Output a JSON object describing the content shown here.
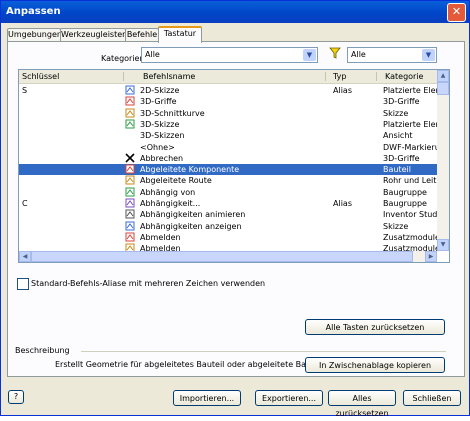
{
  "window": {
    "title": "Anpassen",
    "close_glyph": "✕"
  },
  "tabs": [
    "Umgebungen",
    "Werkzeugleisten",
    "Befehle",
    "Tastatur"
  ],
  "active_tab": "Tastatur",
  "kategorie": {
    "label": "Kategorien",
    "value": "Alle"
  },
  "filter": {
    "icon": "funnel-icon",
    "value": "Alle"
  },
  "table": {
    "columns": [
      "Schlüssel",
      "Befehlsname",
      "Typ",
      "Kategorie"
    ],
    "rows": [
      {
        "key": "S",
        "name": "2D-Skizze",
        "type": "Alias",
        "cat": "Platzierte Eleme",
        "icon": "sketch-2d-icon"
      },
      {
        "key": "",
        "name": "3D-Griffe",
        "type": "",
        "cat": "3D-Griffe",
        "icon": "grip-3d-icon"
      },
      {
        "key": "",
        "name": "3D-Schnittkurve",
        "type": "",
        "cat": "Skizze",
        "icon": "intersection-curve-icon"
      },
      {
        "key": "",
        "name": "3D-Skizze",
        "type": "",
        "cat": "Platzierte Eleme",
        "icon": "sketch-3d-icon"
      },
      {
        "key": "",
        "name": "3D-Skizzen",
        "type": "",
        "cat": "Ansicht",
        "icon": ""
      },
      {
        "key": "",
        "name": "<Ohne>",
        "type": "",
        "cat": "DWF-Markierun",
        "icon": ""
      },
      {
        "key": "",
        "name": "Abbrechen",
        "type": "",
        "cat": "3D-Griffe",
        "icon": "cancel-x-icon"
      },
      {
        "key": "",
        "name": "Abgeleitete Komponente",
        "type": "",
        "cat": "Bauteil",
        "icon": "derived-component-icon",
        "selected": true
      },
      {
        "key": "",
        "name": "Abgeleitete Route",
        "type": "",
        "cat": "Rohr und Leitur",
        "icon": "derived-route-icon"
      },
      {
        "key": "",
        "name": "Abhängig von",
        "type": "",
        "cat": "Baugruppe",
        "icon": "depends-on-icon"
      },
      {
        "key": "C",
        "name": "Abhängigkeit...",
        "type": "Alias",
        "cat": "Baugruppe",
        "icon": "constraint-icon"
      },
      {
        "key": "",
        "name": "Abhängigkeiten animieren",
        "type": "",
        "cat": "Inventor Studio",
        "icon": "animate-constraints-icon"
      },
      {
        "key": "",
        "name": "Abhängigkeiten anzeigen",
        "type": "",
        "cat": "Skizze",
        "icon": "show-constraints-icon"
      },
      {
        "key": "",
        "name": "Abmelden",
        "type": "",
        "cat": "Zusatzmodule",
        "icon": "logout-icon"
      },
      {
        "key": "",
        "name": "Abmelden",
        "type": "",
        "cat": "Zusatzmodule",
        "icon": "logout-icon"
      }
    ]
  },
  "alias_checkbox": {
    "label": "Standard-Befehls-Aliase mit mehreren Zeichen verwenden",
    "checked": false
  },
  "reset_keys_button": "Alle Tasten zurücksetzen",
  "description": {
    "heading": "Beschreibung",
    "text": "Erstellt Geometrie für abgeleitetes Bauteil oder abgeleitete Baugruppe"
  },
  "copy_button": "In Zwischenablage kopieren",
  "footer": {
    "help_icon": "help-icon",
    "import": "Importieren...",
    "export": "Exportieren...",
    "reset_all": "Alles zurücksetzen",
    "close": "Schließen"
  },
  "colors": {
    "selection": "#316ac5",
    "title": "#0054e3",
    "tab_accent": "#e89a14"
  }
}
